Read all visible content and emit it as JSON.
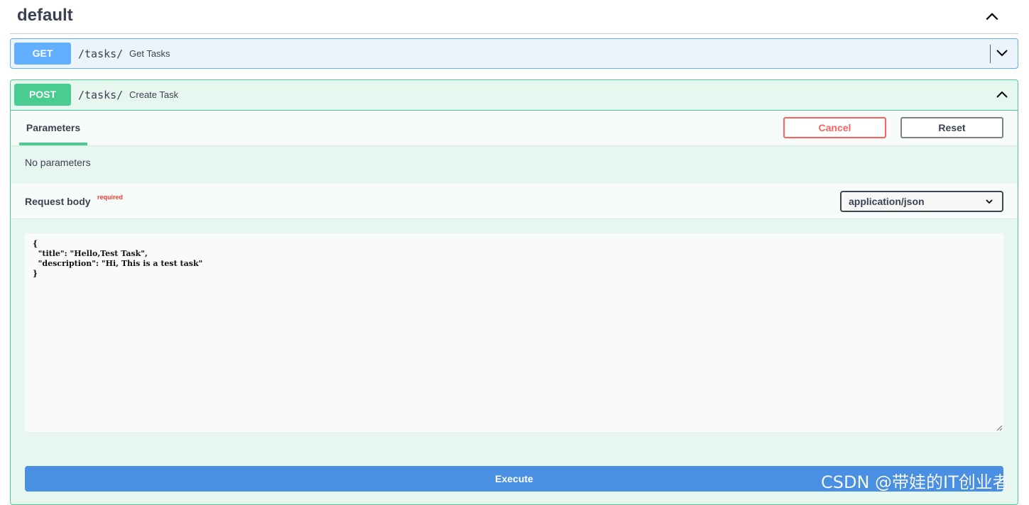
{
  "section": {
    "title": "default"
  },
  "operations": [
    {
      "method": "GET",
      "path": "/tasks/",
      "summary": "Get Tasks"
    },
    {
      "method": "POST",
      "path": "/tasks/",
      "summary": "Create Task"
    }
  ],
  "post_panel": {
    "tab_label": "Parameters",
    "cancel_label": "Cancel",
    "reset_label": "Reset",
    "no_params_text": "No parameters",
    "request_body_label": "Request body",
    "required_label": "required",
    "content_type": "application/json",
    "body_text": "{\n  \"title\": \"Hello,Test Task\",\n  \"description\": \"Hi, This is a test task\"\n}",
    "execute_label": "Execute"
  },
  "watermark": "CSDN @带娃的IT创业者",
  "colors": {
    "get": "#61affe",
    "post": "#49cc90",
    "execute": "#4990e2",
    "cancel": "#ff6060"
  },
  "icons": {
    "section_toggle": "chevron-up-icon",
    "get_toggle": "chevron-down-icon",
    "post_toggle": "chevron-up-icon",
    "select": "chevron-down-icon"
  }
}
